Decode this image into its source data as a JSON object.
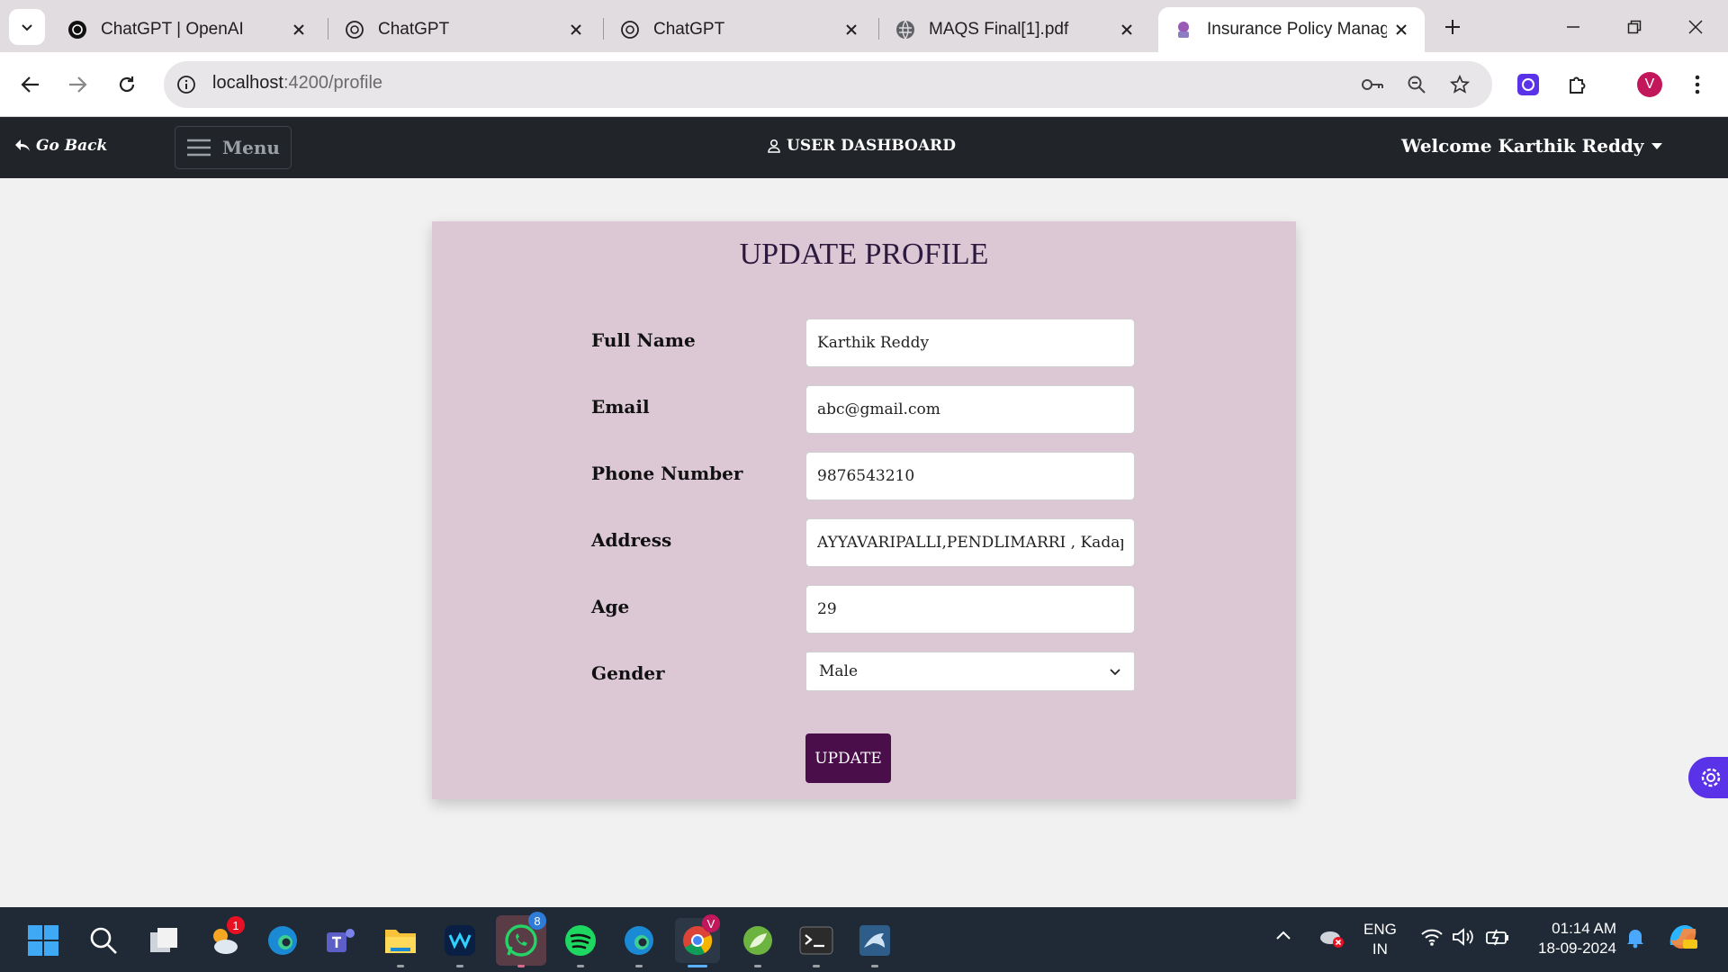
{
  "browser": {
    "tabs": [
      {
        "title": "ChatGPT | OpenAI",
        "icon": "chatgpt-icon"
      },
      {
        "title": "ChatGPT",
        "icon": "chatgpt-icon"
      },
      {
        "title": "ChatGPT",
        "icon": "chatgpt-icon"
      },
      {
        "title": "MAQS Final[1].pdf",
        "icon": "globe-icon"
      },
      {
        "title": "Insurance Policy Management",
        "icon": "app-icon",
        "active": true
      }
    ],
    "url_host": "localhost",
    "url_path": ":4200/profile",
    "profile_initial": "V"
  },
  "navbar": {
    "go_back": "Go Back",
    "menu": "Menu",
    "dashboard": "USER DASHBOARD",
    "welcome": "Welcome Karthik Reddy"
  },
  "form": {
    "title": "UPDATE PROFILE",
    "full_name_label": "Full Name",
    "full_name_value": "Karthik Reddy",
    "email_label": "Email",
    "email_value": "abc@gmail.com",
    "phone_label": "Phone Number",
    "phone_value": "9876543210",
    "address_label": "Address",
    "address_value": "AYYAVARIPALLI,PENDLIMARRI , Kadapa",
    "age_label": "Age",
    "age_value": "29",
    "gender_label": "Gender",
    "gender_value": "Male",
    "submit": "UPDATE"
  },
  "taskbar": {
    "weather_badge": "1",
    "whatsapp_badge": "8",
    "chrome_badge": "V",
    "lang_line1": "ENG",
    "lang_line2": "IN",
    "time": "01:14 AM",
    "date": "18-09-2024"
  },
  "colors": {
    "navbar_bg": "#212529",
    "card_bg": "#dcc7d5",
    "button_bg": "#4a0f4b",
    "taskbar_bg": "#1f2a36"
  }
}
